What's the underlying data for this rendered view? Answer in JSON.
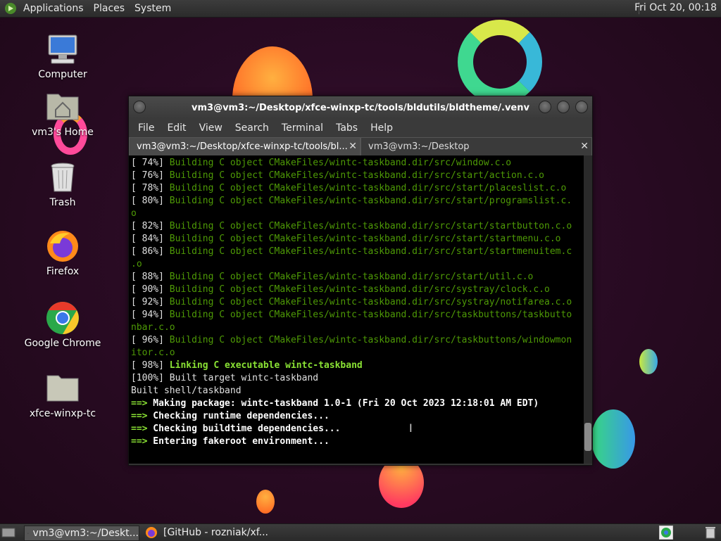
{
  "top_panel": {
    "menus": [
      "Applications",
      "Places",
      "System"
    ],
    "clock": "Fri Oct 20, 00:18"
  },
  "desktop_icons": [
    "Computer",
    "vm3's Home",
    "Trash",
    "Firefox",
    "Google Chrome",
    "xfce-winxp-tc"
  ],
  "window": {
    "title": "vm3@vm3:~/Desktop/xfce-winxp-tc/tools/bldutils/bldtheme/.venv",
    "menus": [
      "File",
      "Edit",
      "View",
      "Search",
      "Terminal",
      "Tabs",
      "Help"
    ],
    "tabs": [
      "vm3@vm3:~/Desktop/xfce-winxp-tc/tools/bl...",
      "vm3@vm3:~/Desktop"
    ]
  },
  "terminal_lines": [
    {
      "pct": "[ 74%]",
      "text": " Building C object CMakeFiles/wintc-taskband.dir/src/window.c.o"
    },
    {
      "pct": "[ 76%]",
      "text": " Building C object CMakeFiles/wintc-taskband.dir/src/start/action.c.o"
    },
    {
      "pct": "[ 78%]",
      "text": " Building C object CMakeFiles/wintc-taskband.dir/src/start/placeslist.c.o"
    },
    {
      "pct": "[ 80%]",
      "text": " Building C object CMakeFiles/wintc-taskband.dir/src/start/programslist.c."
    },
    {
      "pct": "",
      "text": "o"
    },
    {
      "pct": "[ 82%]",
      "text": " Building C object CMakeFiles/wintc-taskband.dir/src/start/startbutton.c.o"
    },
    {
      "pct": "[ 84%]",
      "text": " Building C object CMakeFiles/wintc-taskband.dir/src/start/startmenu.c.o"
    },
    {
      "pct": "[ 86%]",
      "text": " Building C object CMakeFiles/wintc-taskband.dir/src/start/startmenuitem.c"
    },
    {
      "pct": "",
      "text": ".o"
    },
    {
      "pct": "[ 88%]",
      "text": " Building C object CMakeFiles/wintc-taskband.dir/src/start/util.c.o"
    },
    {
      "pct": "[ 90%]",
      "text": " Building C object CMakeFiles/wintc-taskband.dir/src/systray/clock.c.o"
    },
    {
      "pct": "[ 92%]",
      "text": " Building C object CMakeFiles/wintc-taskband.dir/src/systray/notifarea.c.o"
    },
    {
      "pct": "[ 94%]",
      "text": " Building C object CMakeFiles/wintc-taskband.dir/src/taskbuttons/taskbutto"
    },
    {
      "pct": "",
      "text": "nbar.c.o"
    },
    {
      "pct": "[ 96%]",
      "text": " Building C object CMakeFiles/wintc-taskband.dir/src/taskbuttons/windowmon"
    },
    {
      "pct": "",
      "text": "itor.c.o"
    }
  ],
  "terminal_tail": {
    "link_pct": "[ 98%]",
    "link_text": " Linking C executable wintc-taskband",
    "built_target": "[100%] Built target wintc-taskband",
    "built_shell": "Built shell/taskband",
    "arrow": "==>",
    "making": " Making package: wintc-taskband 1.0-1 (Fri 20 Oct 2023 12:18:01 AM EDT)",
    "checking_runtime": " Checking runtime dependencies...",
    "checking_buildtime": " Checking buildtime dependencies...",
    "entering": " Entering fakeroot environment..."
  },
  "taskbar": {
    "tasks": [
      "vm3@vm3:~/Deskt...",
      "[GitHub - rozniak/xf..."
    ]
  }
}
